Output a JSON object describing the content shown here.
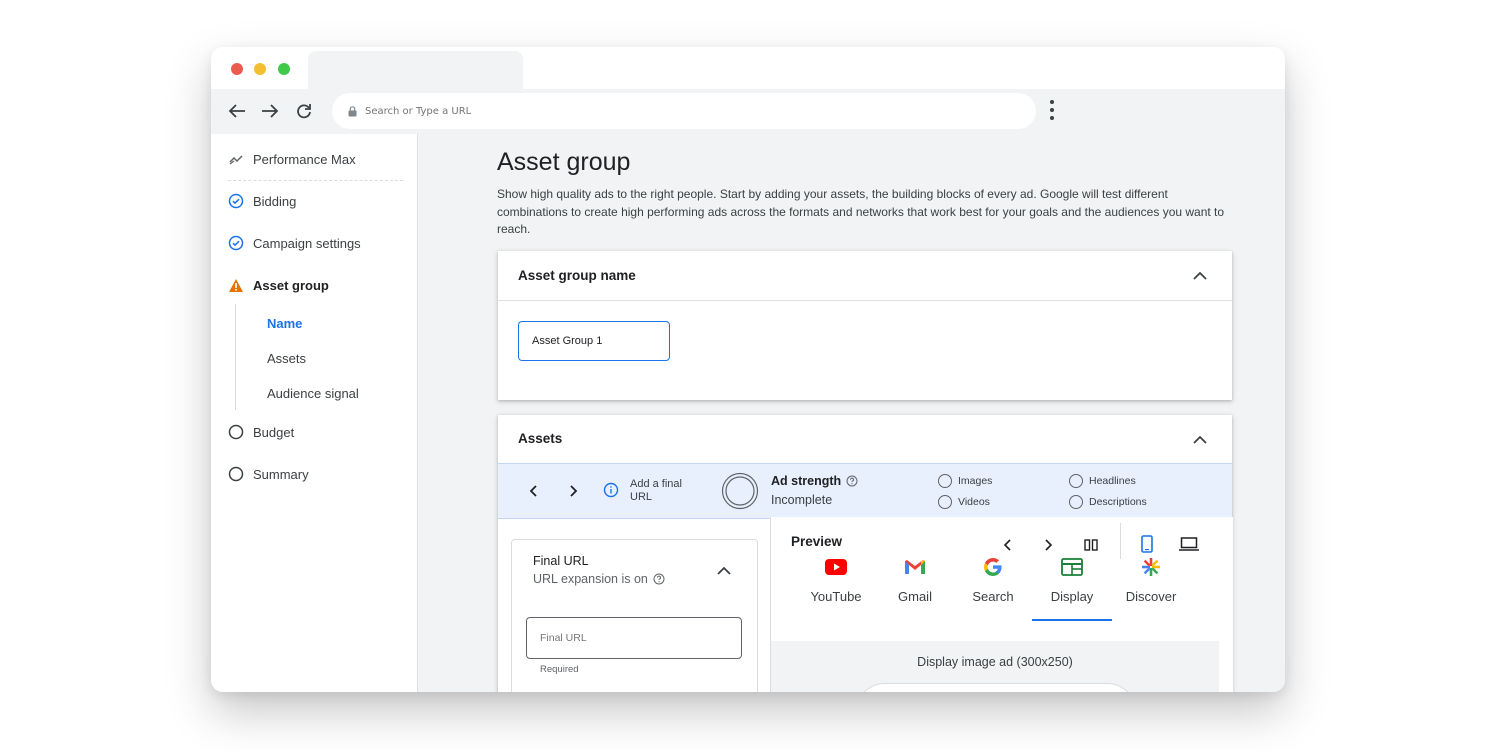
{
  "browser": {
    "url_placeholder": "Search or Type a URL",
    "traffic_colors": {
      "close": "#ee5a52",
      "minimize": "#f5be2e",
      "maximize": "#41c94a"
    }
  },
  "sidebar": {
    "items": [
      {
        "label": "Performance Max",
        "icon": "performance-icon",
        "state": "default"
      },
      {
        "label": "Bidding",
        "icon": "check-circle-icon",
        "state": "complete"
      },
      {
        "label": "Campaign settings",
        "icon": "check-circle-icon",
        "state": "complete"
      },
      {
        "label": "Asset group",
        "icon": "warning-icon",
        "state": "warning"
      },
      {
        "label": "Budget",
        "icon": "empty-circle-icon",
        "state": "incomplete"
      },
      {
        "label": "Summary",
        "icon": "empty-circle-icon",
        "state": "incomplete"
      }
    ],
    "subitems": [
      {
        "label": "Name",
        "active": true
      },
      {
        "label": "Assets",
        "active": false
      },
      {
        "label": "Audience signal",
        "active": false
      }
    ]
  },
  "main": {
    "title": "Asset group",
    "description": "Show high quality ads to the right people. Start by adding your assets, the building blocks of every ad. Google will test different combinations to create high performing ads across the formats and networks that work best for your goals and the audiences you want to reach."
  },
  "name_card": {
    "title": "Asset group name",
    "input_value": "Asset Group 1"
  },
  "assets_card": {
    "title": "Assets",
    "strip": {
      "add_url_line1": "Add a final",
      "add_url_line2": "URL",
      "ad_strength_label": "Ad strength",
      "ad_strength_value": "Incomplete",
      "checks": [
        "Images",
        "Videos",
        "Headlines",
        "Descriptions"
      ]
    },
    "final_url": {
      "title": "Final URL",
      "expansion": "URL expansion is on",
      "placeholder": "Final URL",
      "helper": "Required"
    },
    "preview": {
      "title": "Preview",
      "tabs": [
        {
          "label": "YouTube",
          "icon": "youtube-icon"
        },
        {
          "label": "Gmail",
          "icon": "gmail-icon"
        },
        {
          "label": "Search",
          "icon": "google-icon"
        },
        {
          "label": "Display",
          "icon": "display-icon",
          "active": true
        },
        {
          "label": "Discover",
          "icon": "discover-icon"
        }
      ],
      "format_label": "Display image ad (300x250)"
    }
  },
  "colors": {
    "accent": "#1a73e8",
    "warning": "#e37400"
  }
}
